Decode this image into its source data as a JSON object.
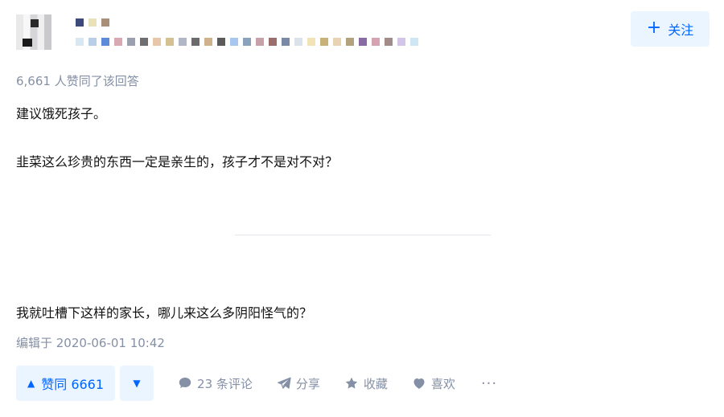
{
  "header": {
    "follow_label": "关注"
  },
  "answer": {
    "votes_text": "6,661 人赞同了该回答",
    "paragraphs": [
      "建议饿死孩子。",
      "韭菜这么珍贵的东西一定是亲生的，孩子才不是对不对？",
      "我就吐槽下这样的家长，哪儿来这么多阴阳怪气的？"
    ],
    "edited": "编辑于 2020-06-01 10:42"
  },
  "actions": {
    "upvote_label": "赞同 6661",
    "comments_label": "23 条评论",
    "share_label": "分享",
    "favorite_label": "收藏",
    "like_label": "喜欢",
    "more_label": "···"
  },
  "colors": {
    "accent": "#0066ff",
    "accent_bg": "#ebf5ff",
    "muted": "#8590a6"
  },
  "icons": {
    "follow": "plus-icon",
    "upvote": "triangle-up-icon",
    "downvote": "triangle-down-icon",
    "comment": "comment-bubble-icon",
    "share": "paper-plane-icon",
    "favorite": "star-icon",
    "like": "heart-icon",
    "more": "ellipsis-icon"
  }
}
